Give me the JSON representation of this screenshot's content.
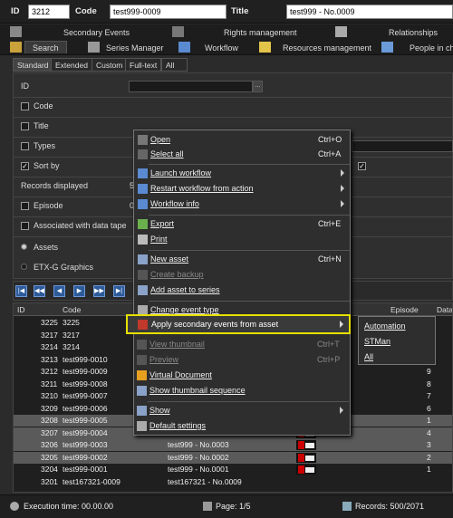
{
  "header": {
    "id_label": "ID",
    "id_value": "3212",
    "code_label": "Code",
    "code_value": "test999-0009",
    "title_label": "Title",
    "title_value": "test999 - No.0009"
  },
  "tabs_row1": [
    {
      "label": "Secondary Events"
    },
    {
      "label": "Rights management"
    },
    {
      "label": "Relationships"
    }
  ],
  "tabs_row2": [
    {
      "label": "Search"
    },
    {
      "label": "Series Manager"
    },
    {
      "label": "Workflow"
    },
    {
      "label": "Resources management"
    },
    {
      "label": "People in ch"
    }
  ],
  "subtabs": [
    {
      "label": "Standard"
    },
    {
      "label": "Extended"
    },
    {
      "label": "Custom"
    },
    {
      "label": "Full-text"
    },
    {
      "label": "All"
    }
  ],
  "form": {
    "id_label": "ID",
    "code_label": "Code",
    "title_label": "Title",
    "types_label": "Types",
    "sortby_label": "Sort by",
    "records_label": "Records displayed",
    "records_value": "5",
    "episode_label": "Episode",
    "episode_value": "0",
    "tape_label": "Associated with data tape",
    "assets_label": "Assets",
    "etx_label": "ETX-G Graphics",
    "browse_label": "..."
  },
  "grid": {
    "headers": {
      "id": "ID",
      "code": "Code",
      "episode": "Episode",
      "data": "Data"
    },
    "rows": [
      {
        "id": "3225",
        "code": "3225",
        "title": "",
        "episode": "",
        "thumb": false,
        "selected": false
      },
      {
        "id": "3217",
        "code": "3217",
        "title": "",
        "episode": "",
        "thumb": false,
        "selected": false
      },
      {
        "id": "3214",
        "code": "3214",
        "title": "",
        "episode": "",
        "thumb": false,
        "selected": false
      },
      {
        "id": "3213",
        "code": "test999-0010",
        "title": "",
        "episode": "",
        "thumb": false,
        "selected": false
      },
      {
        "id": "3212",
        "code": "test999-0009",
        "title": "",
        "episode": "9",
        "thumb": false,
        "selected": false
      },
      {
        "id": "3211",
        "code": "test999-0008",
        "title": "",
        "episode": "8",
        "thumb": false,
        "selected": false
      },
      {
        "id": "3210",
        "code": "test999-0007",
        "title": "",
        "episode": "7",
        "thumb": false,
        "selected": false
      },
      {
        "id": "3209",
        "code": "test999-0006",
        "title": "",
        "episode": "6",
        "thumb": false,
        "selected": false
      },
      {
        "id": "3208",
        "code": "test999-0005",
        "title": "",
        "episode": "1",
        "thumb": false,
        "selected": true
      },
      {
        "id": "3207",
        "code": "test999-0004",
        "title": "test999 - No.0004",
        "episode": "4",
        "thumb": true,
        "selected": true
      },
      {
        "id": "3206",
        "code": "test999-0003",
        "title": "test999 - No.0003",
        "episode": "3",
        "thumb": true,
        "selected": true
      },
      {
        "id": "3205",
        "code": "test999-0002",
        "title": "test999 - No.0002",
        "episode": "2",
        "thumb": true,
        "selected": true
      },
      {
        "id": "3204",
        "code": "test999-0001",
        "title": "test999 - No.0001",
        "episode": "1",
        "thumb": true,
        "selected": false
      },
      {
        "id": "3201",
        "code": "test167321-0009",
        "title": "test167321 - No.0009",
        "episode": "",
        "thumb": false,
        "selected": false
      }
    ]
  },
  "status": {
    "execution": "Execution time: 00.00.00",
    "page": "Page: 1/5",
    "records": "Records: 500/2071"
  },
  "menu": {
    "items": [
      {
        "label": "Open",
        "shortcut": "Ctrl+O"
      },
      {
        "label": "Select all",
        "shortcut": "Ctrl+A"
      },
      {
        "label": "Launch workflow",
        "shortcut": ""
      },
      {
        "label": "Restart workflow from action",
        "shortcut": ""
      },
      {
        "label": "Workflow info",
        "shortcut": ""
      },
      {
        "label": "Export",
        "shortcut": "Ctrl+E"
      },
      {
        "label": "Print",
        "shortcut": ""
      },
      {
        "label": "New asset",
        "shortcut": "Ctrl+N"
      },
      {
        "label": "Create backup",
        "shortcut": ""
      },
      {
        "label": "Add asset to series",
        "shortcut": ""
      },
      {
        "label": "Change event type",
        "shortcut": ""
      },
      {
        "label": "Apply secondary events from asset",
        "shortcut": ""
      },
      {
        "label": "View thumbnail",
        "shortcut": "Ctrl+T"
      },
      {
        "label": "Preview",
        "shortcut": "Ctrl+P"
      },
      {
        "label": "Virtual Document",
        "shortcut": ""
      },
      {
        "label": "Show thumbnail sequence",
        "shortcut": ""
      },
      {
        "label": "Show",
        "shortcut": ""
      },
      {
        "label": "Default settings",
        "shortcut": ""
      }
    ]
  },
  "submenu": {
    "items": [
      {
        "label": "Automation"
      },
      {
        "label": "STMan"
      },
      {
        "label": "All"
      }
    ]
  },
  "colors": {
    "highlight": "#e6e000",
    "background": "#2b2b2b",
    "selected_row": "#5a5a5a"
  }
}
